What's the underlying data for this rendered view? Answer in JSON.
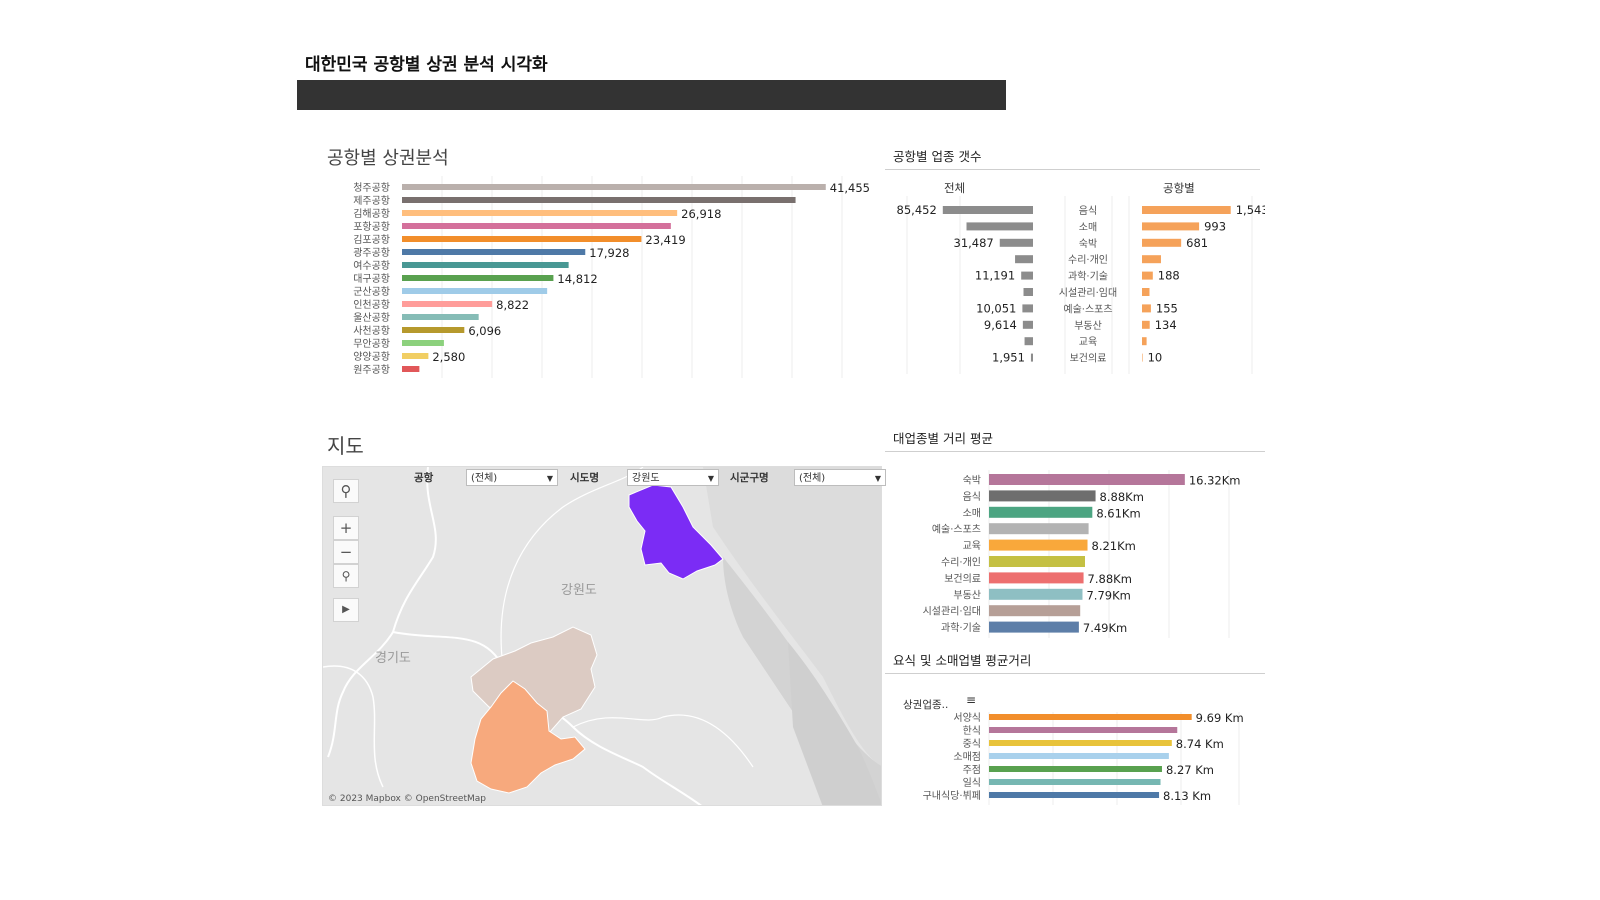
{
  "header": {
    "title": "대한민국 공항별 상권 분석 시각화"
  },
  "airport_chart": {
    "title": "공항별 상권분석",
    "chart_data": {
      "type": "bar",
      "orientation": "horizontal",
      "categories": [
        "청주공항",
        "제주공항",
        "김해공항",
        "포항공항",
        "김포공항",
        "광주공항",
        "여수공항",
        "대구공항",
        "군산공항",
        "인천공항",
        "울산공항",
        "사천공항",
        "무안공항",
        "양양공항",
        "원주공항"
      ],
      "values": [
        41455,
        38500,
        26918,
        26300,
        23419,
        17928,
        16300,
        14812,
        14200,
        8822,
        7500,
        6096,
        4100,
        2580,
        1700
      ],
      "value_labels": [
        "41,455",
        "",
        "26,918",
        "",
        "23,419",
        "17,928",
        "",
        "14,812",
        "",
        "8,822",
        "",
        "6,096",
        "",
        "2,580",
        ""
      ],
      "colors": [
        "#bab0ac",
        "#79706e",
        "#ffbe7d",
        "#d4709b",
        "#f28e2b",
        "#4e79a7",
        "#499894",
        "#59a14f",
        "#9fcbe8",
        "#ff9d9a",
        "#86bcb6",
        "#b6992d",
        "#8cd17d",
        "#f1ce63",
        "#e15759"
      ],
      "xlim": [
        0,
        45000
      ]
    }
  },
  "industry_count": {
    "title": "공항별 업종 갯수",
    "col_total": "전체",
    "col_airport": "공항별",
    "chart_data": {
      "type": "bar",
      "orientation": "horizontal",
      "categories": [
        "음식",
        "소매",
        "숙박",
        "수리·개인",
        "과학·기술",
        "시설관리·임대",
        "예술·스포츠",
        "부동산",
        "교육",
        "보건의료"
      ],
      "series": [
        {
          "name": "전체",
          "values": [
            85452,
            63000,
            31487,
            17000,
            11191,
            9000,
            10051,
            9614,
            8000,
            1951
          ],
          "labels": [
            "85,452",
            "",
            "31,487",
            "",
            "11,191",
            "",
            "10,051",
            "9,614",
            "",
            "1,951"
          ],
          "color": "#8c8c8c"
        },
        {
          "name": "공항별",
          "values": [
            1543,
            993,
            681,
            330,
            188,
            130,
            155,
            134,
            80,
            10
          ],
          "labels": [
            "1,543",
            "993",
            "681",
            "",
            "188",
            "",
            "155",
            "134",
            "",
            "10"
          ],
          "color": "#f5a25a"
        }
      ],
      "xlim_total": [
        0,
        90000
      ],
      "xlim_airport": [
        0,
        1600
      ]
    }
  },
  "map_section": {
    "title": "지도",
    "filters": [
      {
        "label": "공항",
        "value": "(전체)"
      },
      {
        "label": "시도명",
        "value": "강원도"
      },
      {
        "label": "시군구명",
        "value": "(전체)"
      }
    ],
    "region_labels": {
      "gangwon": "강원도",
      "gyeonggi": "경기도"
    },
    "tool_icons": [
      "search-icon",
      "zoom-in-icon",
      "zoom-out-icon",
      "pin-icon",
      "play-icon"
    ],
    "attribution": "© 2023 Mapbox © OpenStreetMap",
    "region_colors": {
      "purple": "#7b2cf5",
      "taupe": "#dccbc3",
      "orange": "#f7a97d"
    }
  },
  "distance_chart": {
    "title": "대업종별 거리 평균",
    "chart_data": {
      "type": "bar",
      "orientation": "horizontal",
      "categories": [
        "숙박",
        "음식",
        "소매",
        "예술·스포츠",
        "교육",
        "수리·개인",
        "보건의료",
        "부동산",
        "시설관리·임대",
        "과학·기술"
      ],
      "values": [
        16.32,
        8.88,
        8.61,
        8.3,
        8.21,
        8.0,
        7.88,
        7.79,
        7.6,
        7.49
      ],
      "value_labels": [
        "16.32Km",
        "8.88Km",
        "8.61Km",
        "",
        "8.21Km",
        "",
        "7.88Km",
        "7.79Km",
        "",
        "7.49Km"
      ],
      "colors": [
        "#b5769a",
        "#6e6e6e",
        "#4ca582",
        "#b3b3b3",
        "#f9a83b",
        "#c4c043",
        "#ed6f6f",
        "#8ebfc3",
        "#b69f97",
        "#5d7ea8"
      ],
      "xlim": [
        0,
        20
      ]
    }
  },
  "food_retail_chart": {
    "title": "요식 및 소매업별 평균거리",
    "column_header": "상권업종..",
    "sort_icon": "sort-icon",
    "chart_data": {
      "type": "bar",
      "orientation": "horizontal",
      "categories": [
        "서양식",
        "한식",
        "중식",
        "소매점",
        "주점",
        "일식",
        "구내식당·뷔페"
      ],
      "values": [
        9.69,
        9.0,
        8.74,
        8.6,
        8.27,
        8.2,
        8.13
      ],
      "value_labels": [
        "9.69 Km",
        "",
        "8.74 Km",
        "",
        "8.27 Km",
        "",
        "8.13 Km"
      ],
      "colors": [
        "#f28e2b",
        "#b5769a",
        "#e8c33b",
        "#a9d1ec",
        "#59a14f",
        "#76b7b2",
        "#4e79a7"
      ],
      "xlim": [
        0,
        12
      ]
    }
  }
}
